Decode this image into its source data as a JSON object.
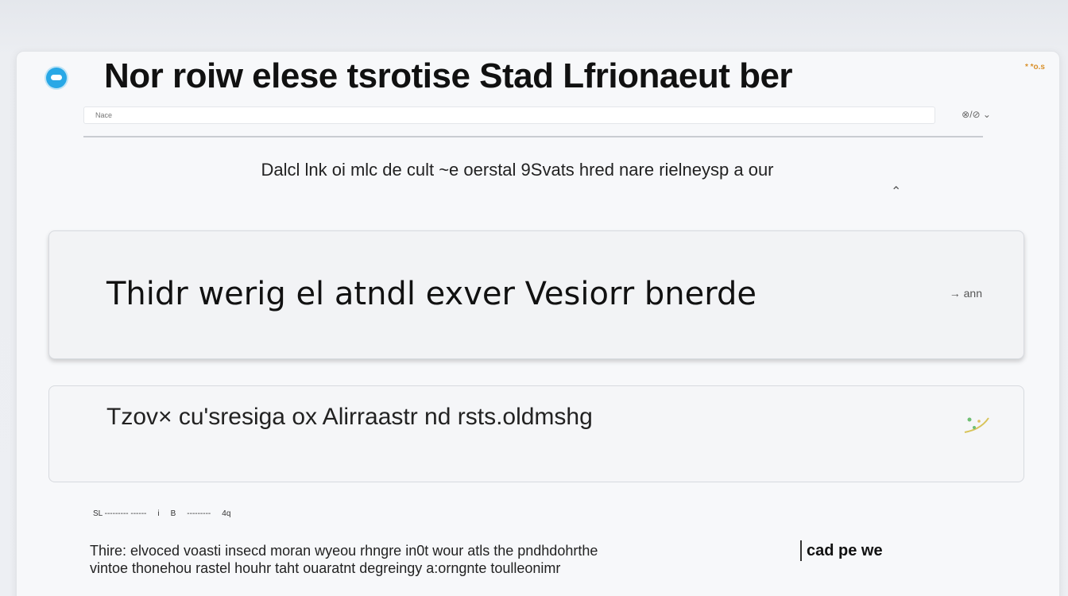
{
  "window": {
    "title": "Nor roiw elese tsrotise Stad Lfrionaeut ber",
    "corner_label": "* *o.s"
  },
  "search": {
    "placeholder": "Nace",
    "action_label": "⊗/⊘ ⌄"
  },
  "subtitle": "Dalcl lnk oi mlc de cult ~e oerstal 9Svats hred nare rielneysp a our",
  "cards": [
    {
      "label": "Thidr werig el atndl exver Vesiorr bnerde",
      "action": "→ ann"
    },
    {
      "label": "Tzov× cu'sresiga ox Alirraastr nd rsts.oldmshg"
    }
  ],
  "meta_row": [
    "SL --------- ------",
    "i",
    "B",
    "---------",
    "4q"
  ],
  "body_text": {
    "line1": "Thire: elvoced voasti insecd moran wyeou rhngre in0t wour atls the pndhdohrthe",
    "line2": "vintoe thonehou rastel houhr taht ouaratnt degreingy a:orngnte toulleonimr"
  },
  "inline_button": "cad pe we",
  "colors": {
    "accent": "#29a8e6",
    "corner_label": "#d9902a"
  }
}
